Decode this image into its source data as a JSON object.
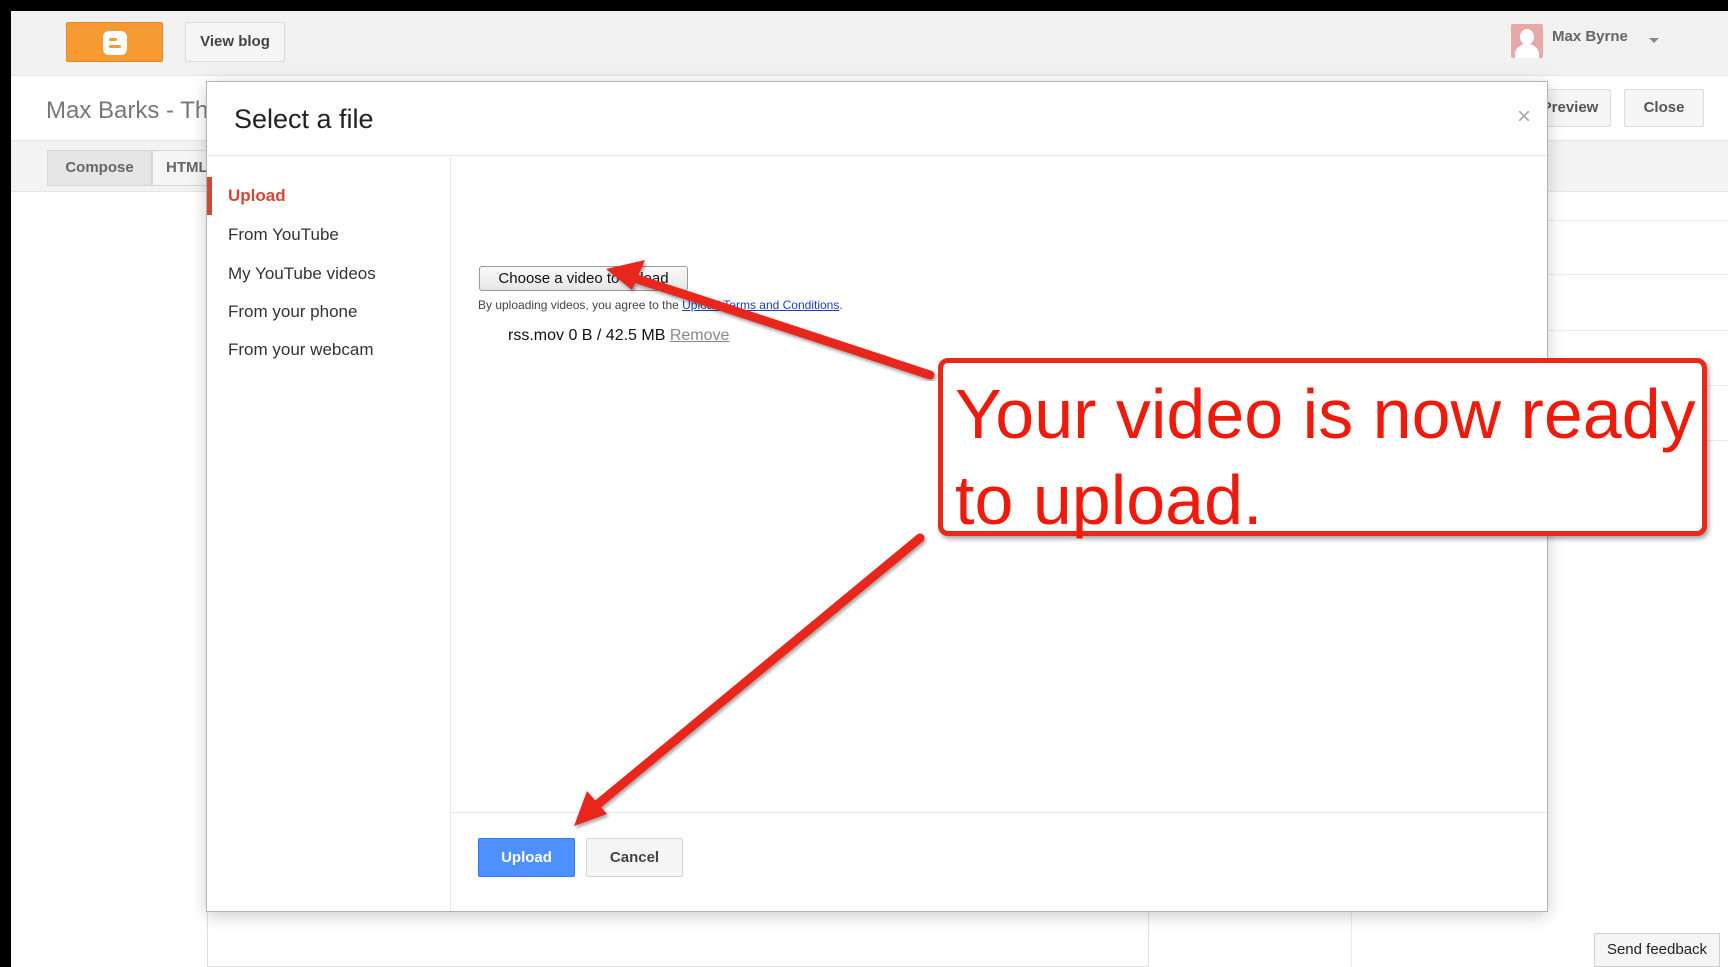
{
  "header": {
    "view_blog": "View blog",
    "user_name": "Max Byrne"
  },
  "editor": {
    "post_title": "Max Barks - Th",
    "preview": "Preview",
    "close": "Close",
    "tab_compose": "Compose",
    "tab_html": "HTML",
    "send_feedback": "Send feedback"
  },
  "modal": {
    "title": "Select a file",
    "close_icon": "×",
    "sidebar": [
      {
        "label": "Upload",
        "active": true
      },
      {
        "label": "From YouTube",
        "active": false
      },
      {
        "label": "My YouTube videos",
        "active": false
      },
      {
        "label": "From your phone",
        "active": false
      },
      {
        "label": "From your webcam",
        "active": false
      }
    ],
    "choose_button": "Choose a video to upload",
    "terms_prefix": "By uploading videos, you agree to the ",
    "terms_link": "Upload Terms and Conditions",
    "terms_suffix": ".",
    "file": {
      "name_size": "rss.mov 0 B / 42.5 MB",
      "remove": "Remove"
    },
    "upload_button": "Upload",
    "cancel_button": "Cancel"
  },
  "annotation": {
    "callout_line1": "Your video is now ready",
    "callout_line2": "to upload."
  },
  "colors": {
    "blogger_orange": "#f79a32",
    "active_red": "#d14836",
    "primary_blue": "#4d90fe",
    "annotation_red": "#e8281a"
  },
  "icons": {
    "logo": "blogger-logo-icon",
    "avatar": "avatar-icon",
    "caret": "chevron-down-icon",
    "close": "close-icon"
  }
}
